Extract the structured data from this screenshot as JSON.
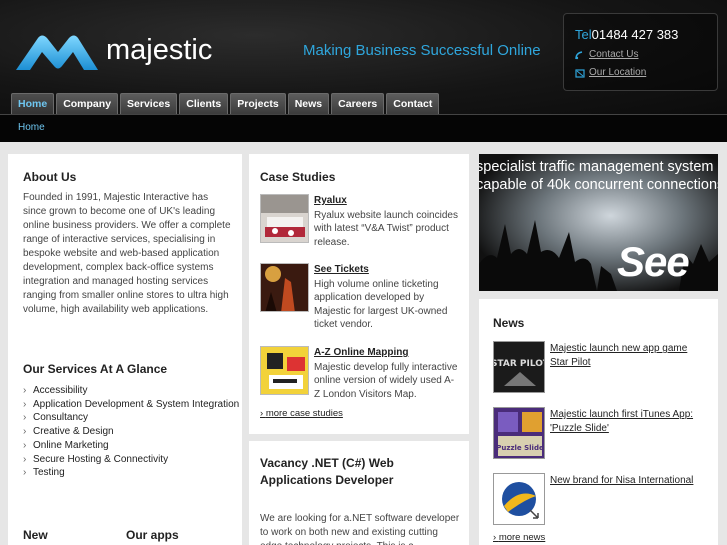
{
  "header": {
    "logo_text": "majestic",
    "tagline": "Making Business Successful Online",
    "tel_label": "Tel",
    "tel_number": "01484 427 383",
    "contact_us": "Contact Us",
    "our_location": "Our Location"
  },
  "nav": {
    "tabs": [
      {
        "label": "Home",
        "active": true
      },
      {
        "label": "Company"
      },
      {
        "label": "Services"
      },
      {
        "label": "Clients"
      },
      {
        "label": "Projects"
      },
      {
        "label": "News"
      },
      {
        "label": "Careers"
      },
      {
        "label": "Contact"
      }
    ]
  },
  "breadcrumb": "Home",
  "about": {
    "title": "About Us",
    "text": "Founded in 1991, Majestic Interactive has since grown to become one of UK's leading online business providers. We offer a complete range of interactive services, specialising in bespoke website and web-based application development, complex back-office systems integration and managed hosting services ranging from smaller online stores to ultra high volume, high availability web applications."
  },
  "services": {
    "title": "Our Services At A Glance",
    "items": [
      "Accessibility",
      "Application Development & System Integration",
      "Consultancy",
      "Creative & Design",
      "Online Marketing",
      "Secure Hosting & Connectivity",
      "Testing"
    ]
  },
  "bottom": {
    "new_title": "New",
    "apps_title": "Our apps"
  },
  "case_studies": {
    "title": "Case Studies",
    "items": [
      {
        "name": "Ryalux",
        "text": "Ryalux website launch coincides with latest “V&A Twist” product release."
      },
      {
        "name": "See Tickets",
        "text": "High volume online ticketing application developed by Majestic for largest UK-owned ticket vendor."
      },
      {
        "name": "A-Z Online Mapping",
        "text": "Majestic develop fully interactive online version of widely used A-Z London Visitors Map."
      }
    ],
    "more": "more case studies"
  },
  "vacancy": {
    "title": "Vacancy .NET (C#) Web Applications Developer",
    "text": "We are looking for a.NET software developer to work on both new and existing cutting edge technology projects. This is a"
  },
  "banner": {
    "line1": "specialist traffic management system",
    "line2": "capable of 40k concurrent connections",
    "logo": "See"
  },
  "news": {
    "title": "News",
    "items": [
      {
        "text": "Majestic launch new app game Star Pilot",
        "thumb_text": "STAR PILOT"
      },
      {
        "text": "Majestic launch first iTunes App: 'Puzzle Slide'",
        "thumb_text": "Puzzle Slide"
      },
      {
        "text": "New brand for Nisa International"
      }
    ],
    "more": "more news"
  },
  "colors": {
    "accent": "#2fa6dc",
    "header_bg": "#151515",
    "page_bg": "#e6e6e6"
  }
}
